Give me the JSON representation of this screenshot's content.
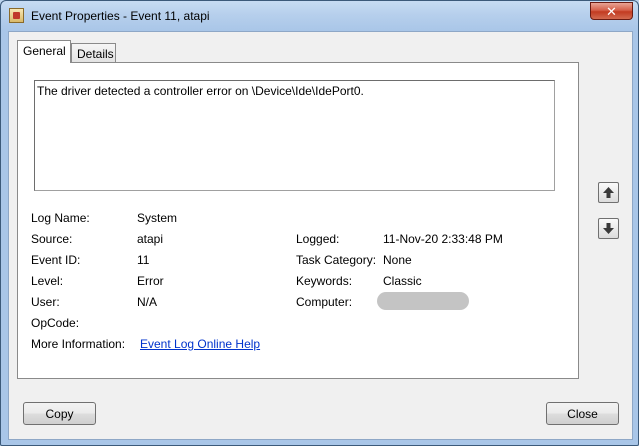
{
  "window": {
    "title": "Event Properties - Event 11, atapi",
    "close_glyph": "✕"
  },
  "tabs": [
    {
      "label": "General",
      "active": true
    },
    {
      "label": "Details",
      "active": false
    }
  ],
  "description": "The driver detected a controller error on \\Device\\Ide\\IdePort0.",
  "fields": {
    "log_name": {
      "label": "Log Name:",
      "value": "System"
    },
    "source": {
      "label": "Source:",
      "value": "atapi"
    },
    "event_id": {
      "label": "Event ID:",
      "value": "11"
    },
    "level": {
      "label": "Level:",
      "value": "Error"
    },
    "user": {
      "label": "User:",
      "value": "N/A"
    },
    "opcode": {
      "label": "OpCode:",
      "value": ""
    },
    "more_info": {
      "label": "More Information:",
      "link": "Event Log Online Help"
    },
    "logged": {
      "label": "Logged:",
      "value": "11-Nov-20 2:33:48 PM"
    },
    "task_category": {
      "label": "Task Category:",
      "value": "None"
    },
    "keywords": {
      "label": "Keywords:",
      "value": "Classic"
    },
    "computer": {
      "label": "Computer:",
      "value": "",
      "redacted": true
    }
  },
  "buttons": {
    "copy": "Copy",
    "close": "Close"
  },
  "icons": {
    "title": "event-viewer-icon",
    "up": "arrow-up-icon",
    "down": "arrow-down-icon"
  }
}
